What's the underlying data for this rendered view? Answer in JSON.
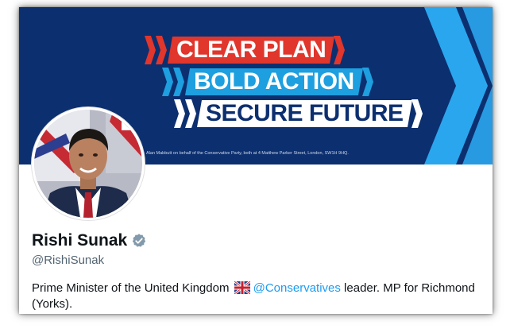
{
  "banner": {
    "line1": "CLEAR PLAN",
    "line2": "BOLD ACTION",
    "line3": "SECURE FUTURE",
    "imprint": "Alan Mabbutt on behalf of the Conservative Party, both at 4 Matthew Parker Street, London, SW1H 9HQ.",
    "colors": {
      "navy": "#0c2f6f",
      "red": "#e0362c",
      "blue": "#1d9fe0",
      "white": "#ffffff",
      "light_blue": "#2aa6ee"
    }
  },
  "profile": {
    "name": "Rishi Sunak",
    "handle": "@RishiSunak",
    "verified_icon": "verified-badge-icon",
    "bio": {
      "prefix": "Prime Minister of the United Kingdom",
      "flag": "uk-flag-icon",
      "mention": "@Conservatives",
      "suffix": " leader. MP for Richmond (Yorks)."
    }
  }
}
